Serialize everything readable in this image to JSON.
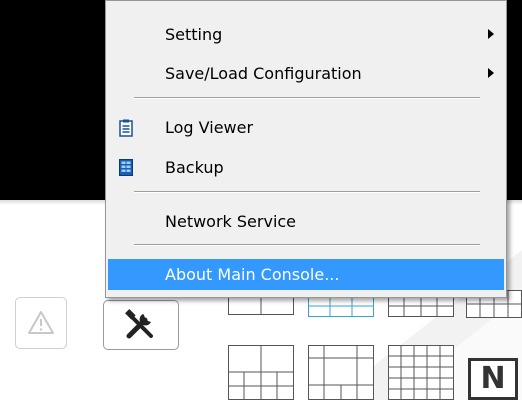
{
  "menu": {
    "items": [
      {
        "label": "Setting",
        "has_submenu": true,
        "icon": ""
      },
      {
        "label": "Save/Load Configuration",
        "has_submenu": true,
        "icon": ""
      },
      {
        "label": "Log Viewer",
        "has_submenu": false,
        "icon": "log-viewer-icon"
      },
      {
        "label": "Backup",
        "has_submenu": false,
        "icon": "backup-icon"
      },
      {
        "label": "Network Service",
        "has_submenu": false,
        "icon": ""
      },
      {
        "label": "About Main Console...",
        "has_submenu": false,
        "icon": "",
        "highlighted": true
      }
    ]
  },
  "toolbar": {
    "alarm_icon": "alarm-warning-icon",
    "tools_icon": "tools-icon"
  },
  "layout_buttons": {
    "badge_letter": "N"
  },
  "colors": {
    "highlight": "#3399ff",
    "menu_bg": "#f0f0f0",
    "video_bg": "#000000",
    "accent_blue": "#3aa0d8"
  }
}
